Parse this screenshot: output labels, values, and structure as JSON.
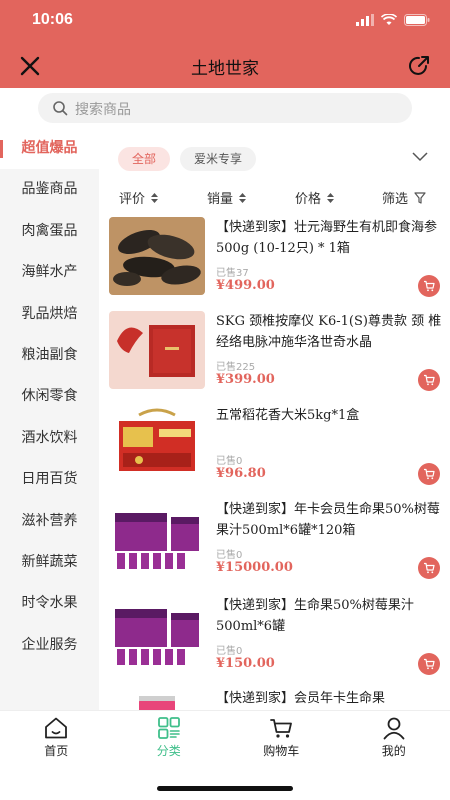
{
  "status": {
    "time": "10:06"
  },
  "header": {
    "title": "土地世家"
  },
  "search": {
    "placeholder": "搜索商品"
  },
  "sidebar": {
    "items": [
      {
        "label": "超值爆品",
        "active": true
      },
      {
        "label": "品鉴商品"
      },
      {
        "label": "肉禽蛋品"
      },
      {
        "label": "海鲜水产"
      },
      {
        "label": "乳品烘焙"
      },
      {
        "label": "粮油副食"
      },
      {
        "label": "休闲零食"
      },
      {
        "label": "酒水饮料"
      },
      {
        "label": "日用百货"
      },
      {
        "label": "滋补营养"
      },
      {
        "label": "新鲜蔬菜"
      },
      {
        "label": "时令水果"
      },
      {
        "label": "企业服务"
      }
    ]
  },
  "filters": {
    "chips": [
      "全部",
      "爱米专享"
    ]
  },
  "sortbar": {
    "rating": "评价",
    "sales": "销量",
    "price": "价格",
    "filter": "筛选"
  },
  "products": [
    {
      "name": "【快递到家】壮元海野生有机即食海参 500g (10-12只) * 1箱",
      "sold": "已售37",
      "price": "¥499.00",
      "thumb": "sea-cucumber"
    },
    {
      "name": "SKG 颈椎按摩仪 K6-1(S)尊贵款 颈 椎经络电脉冲施华洛世奇水晶",
      "sold": "已售225",
      "price": "¥399.00",
      "thumb": "massager"
    },
    {
      "name": "五常稻花香大米5kg*1盒",
      "sold": "已售0",
      "price": "¥96.80",
      "thumb": "rice-box"
    },
    {
      "name": "【快递到家】年卡会员生命果50%树莓果汁500ml*6罐*120箱",
      "sold": "已售0",
      "price": "¥15000.00",
      "thumb": "juice-set"
    },
    {
      "name": "【快递到家】生命果50%树莓果汁500ml*6罐",
      "sold": "已售0",
      "price": "¥150.00",
      "thumb": "juice-set"
    },
    {
      "name": "【快递到家】会员年卡生命果",
      "sold": "",
      "price": "",
      "thumb": "juice-can"
    }
  ],
  "tabbar": {
    "items": [
      {
        "label": "首页",
        "icon": "home-icon"
      },
      {
        "label": "分类",
        "icon": "category-icon",
        "active": true
      },
      {
        "label": "购物车",
        "icon": "cart-icon"
      },
      {
        "label": "我的",
        "icon": "user-icon"
      }
    ]
  },
  "colors": {
    "brand": "#e2655d",
    "active_tab": "#3fbf8a"
  }
}
